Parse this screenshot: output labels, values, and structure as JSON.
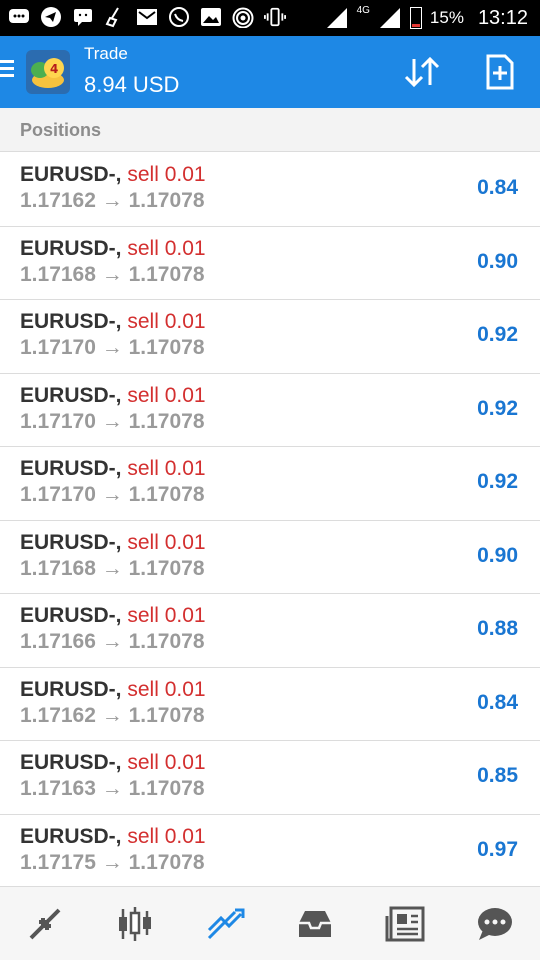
{
  "status_bar": {
    "battery": "15%",
    "network": "4G",
    "time": "13:12"
  },
  "app_bar": {
    "title": "Trade",
    "balance": "8.94 USD"
  },
  "section": {
    "title": "Positions"
  },
  "positions": [
    {
      "symbol": "EURUSD-,",
      "side": "sell 0.01",
      "open": "1.17162",
      "arrow": "→",
      "current": "1.17078",
      "profit": "0.84"
    },
    {
      "symbol": "EURUSD-,",
      "side": "sell 0.01",
      "open": "1.17168",
      "arrow": "→",
      "current": "1.17078",
      "profit": "0.90"
    },
    {
      "symbol": "EURUSD-,",
      "side": "sell 0.01",
      "open": "1.17170",
      "arrow": "→",
      "current": "1.17078",
      "profit": "0.92"
    },
    {
      "symbol": "EURUSD-,",
      "side": "sell 0.01",
      "open": "1.17170",
      "arrow": "→",
      "current": "1.17078",
      "profit": "0.92"
    },
    {
      "symbol": "EURUSD-,",
      "side": "sell 0.01",
      "open": "1.17170",
      "arrow": "→",
      "current": "1.17078",
      "profit": "0.92"
    },
    {
      "symbol": "EURUSD-,",
      "side": "sell 0.01",
      "open": "1.17168",
      "arrow": "→",
      "current": "1.17078",
      "profit": "0.90"
    },
    {
      "symbol": "EURUSD-,",
      "side": "sell 0.01",
      "open": "1.17166",
      "arrow": "→",
      "current": "1.17078",
      "profit": "0.88"
    },
    {
      "symbol": "EURUSD-,",
      "side": "sell 0.01",
      "open": "1.17162",
      "arrow": "→",
      "current": "1.17078",
      "profit": "0.84"
    },
    {
      "symbol": "EURUSD-,",
      "side": "sell 0.01",
      "open": "1.17163",
      "arrow": "→",
      "current": "1.17078",
      "profit": "0.85"
    },
    {
      "symbol": "EURUSD-,",
      "side": "sell 0.01",
      "open": "1.17175",
      "arrow": "→",
      "current": "1.17078",
      "profit": "0.97"
    }
  ],
  "bottom_nav": [
    {
      "icon": "quotes-icon"
    },
    {
      "icon": "chart-icon"
    },
    {
      "icon": "trade-icon",
      "active": true
    },
    {
      "icon": "history-icon"
    },
    {
      "icon": "news-icon"
    },
    {
      "icon": "chat-icon"
    }
  ],
  "colors": {
    "app_bar": "#1e88e5",
    "profit": "#1976d2",
    "sell": "#d32f2f",
    "active_nav": "#1e88e5",
    "inactive_nav": "#555555"
  }
}
